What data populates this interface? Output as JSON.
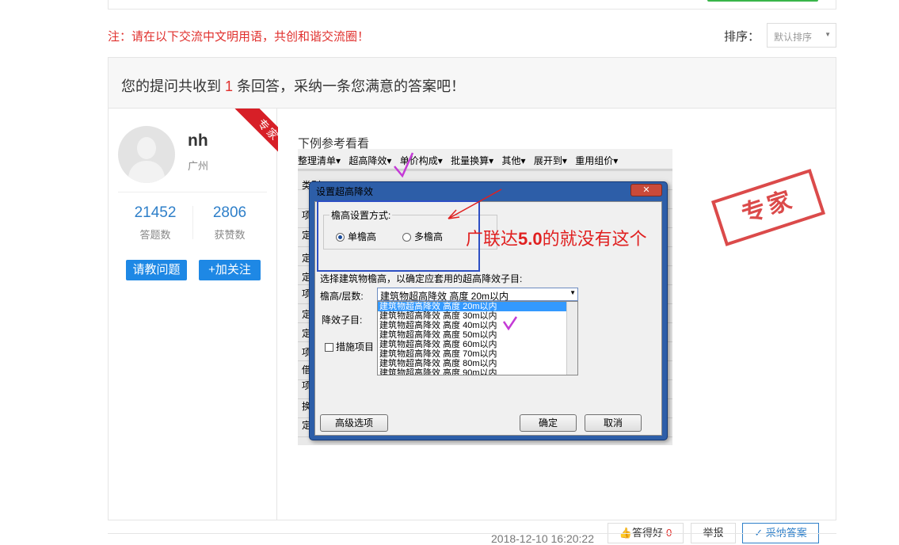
{
  "notice": "注：请在以下交流中文明用语，共创和谐交流圈！",
  "sort": {
    "label": "排序：",
    "selected": "默认排序"
  },
  "answer_header": {
    "prefix": "您的提问共收到",
    "count": "1",
    "suffix": "条回答，采纳一条您满意的答案吧！"
  },
  "answerer": {
    "name": "nh",
    "location": "广州",
    "ribbon": "专家",
    "answers_count": "21452",
    "answers_label": "答题数",
    "likes_count": "2806",
    "likes_label": "获赞数",
    "ask_button": "请教问题",
    "follow_button": "+加关注"
  },
  "answer": {
    "ref_title": "下例参考看看",
    "screenshot": {
      "toolbar": [
        "整理清单▾",
        "超高降效▾",
        "单价构成▾",
        "批量换算▾",
        "其他▾",
        "展开到▾",
        "重用组价▾"
      ],
      "row_labels": [
        "类别",
        "项",
        "定",
        "定",
        "定",
        "项",
        "定",
        "定",
        "项",
        "借",
        "项",
        "换",
        "定"
      ],
      "dialog_title": "设置超高降效",
      "dialog_close": "✕",
      "group_title": "檐高设置方式:",
      "radio_single": "单檐高",
      "radio_multi": "多檐高",
      "instruction": "选择建筑物檐高，以确定应套用的超高降效子目:",
      "height_label": "檐高/层数:",
      "combo_value": "建筑物超高降效 高度 20m以内",
      "subitem_label": "降效子目:",
      "options": [
        "建筑物超高降效 高度 20m以内",
        "建筑物超高降效 高度 30m以内",
        "建筑物超高降效 高度 40m以内",
        "建筑物超高降效 高度 50m以内",
        "建筑物超高降效 高度 60m以内",
        "建筑物超高降效 高度 70m以内",
        "建筑物超高降效 高度 80m以内",
        "建筑物超高降效 高度 90m以内"
      ],
      "measure_label": "措施项目",
      "advanced_button": "高级选项",
      "ok_button": "确定",
      "cancel_button": "取消",
      "annotation_prefix": "广联达",
      "annotation_version": "5.0",
      "annotation_suffix": "的就没有这个"
    },
    "stamp": "专家",
    "timestamp": "2018-12-10 16:20:22",
    "like_label": "答得好",
    "like_count": "0",
    "report_label": "举报",
    "accept_label": "采纳答案"
  }
}
